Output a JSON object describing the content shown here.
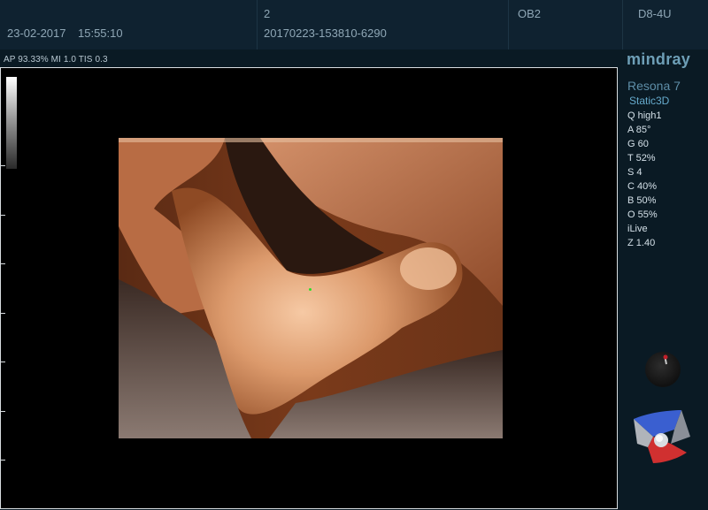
{
  "header": {
    "date": "23-02-2017",
    "time": "15:55:10",
    "number": "2",
    "exam_id": "20170223-153810-6290",
    "exam_type": "OB2",
    "probe": "D8-4U"
  },
  "acoustic_info": "AP 93.33%  MI 1.0 TIS 0.3",
  "side_panel": {
    "brand": "mindray",
    "model": "Resona 7",
    "mode": "Static3D",
    "params": [
      "Q high1",
      "A 85°",
      "G 60",
      "T 52%",
      "S 4",
      "C 40%",
      "B 50%",
      "O 55%",
      "iLive",
      "Z 1.40"
    ]
  },
  "colors": {
    "header_bg": "#0f2230",
    "panel_text": "#d4e0e8",
    "brand": "#6e9fb7",
    "cursor": "#29e02a"
  }
}
